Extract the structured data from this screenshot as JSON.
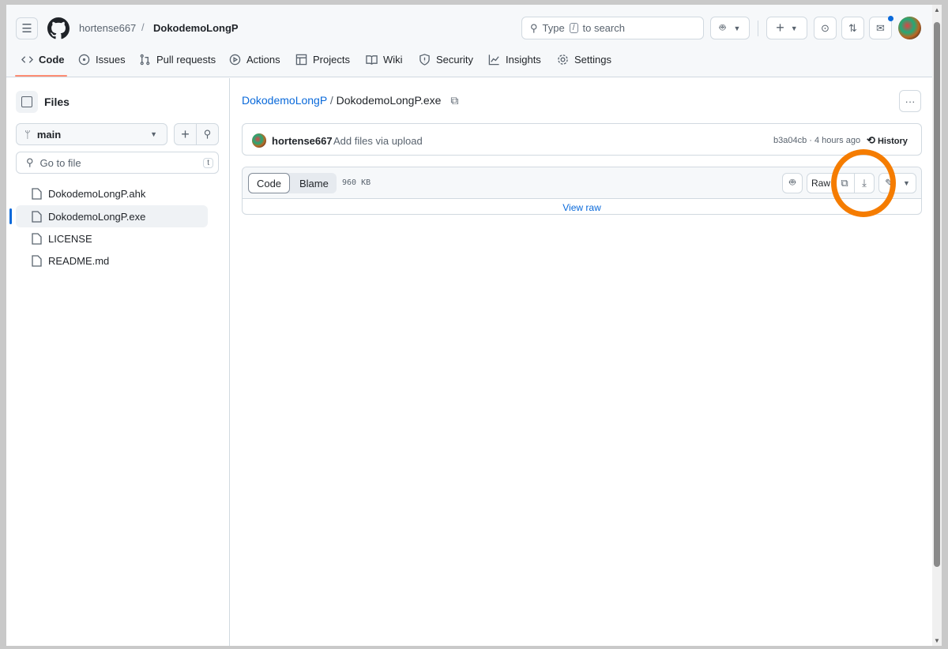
{
  "header": {
    "owner": "hortense667",
    "separator": "/",
    "repo": "DokodemoLongP",
    "search_prefix": "Type",
    "search_key": "/",
    "search_suffix": "to search"
  },
  "tabs": [
    {
      "label": "Code",
      "icon": "code-icon"
    },
    {
      "label": "Issues",
      "icon": "issue-icon"
    },
    {
      "label": "Pull requests",
      "icon": "pull-request-icon"
    },
    {
      "label": "Actions",
      "icon": "play-icon"
    },
    {
      "label": "Projects",
      "icon": "table-icon"
    },
    {
      "label": "Wiki",
      "icon": "book-icon"
    },
    {
      "label": "Security",
      "icon": "shield-icon"
    },
    {
      "label": "Insights",
      "icon": "graph-icon"
    },
    {
      "label": "Settings",
      "icon": "gear-icon"
    }
  ],
  "sidebar": {
    "title": "Files",
    "branch": "main",
    "go_to_file": "Go to file",
    "shortcut": "t",
    "files": [
      "DokodemoLongP.ahk",
      "DokodemoLongP.exe",
      "LICENSE",
      "README.md"
    ]
  },
  "content": {
    "breadcrumb_repo": "DokodemoLongP",
    "breadcrumb_sep": "/",
    "breadcrumb_file": "DokodemoLongP.exe",
    "commit_author": "hortense667",
    "commit_message": "Add files via upload",
    "commit_meta": "b3a04cb · 4 hours ago",
    "history": "History",
    "code_tab": "Code",
    "blame_tab": "Blame",
    "file_size": "960 KB",
    "raw": "Raw",
    "view_raw": "View raw"
  },
  "colors": {
    "accent": "#0969da",
    "highlight": "#f57c00",
    "active_tab": "#fd8c73"
  }
}
